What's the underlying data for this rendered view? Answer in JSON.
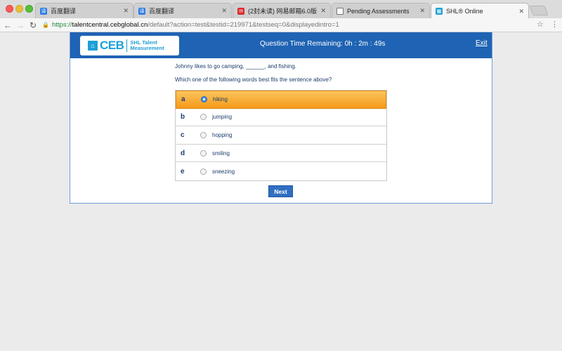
{
  "browser": {
    "tabs": [
      {
        "label": "百度翻译",
        "icon": "baidu-translate-icon"
      },
      {
        "label": "百度翻译",
        "icon": "baidu-translate-icon"
      },
      {
        "label": "(2封未读) 网易邮箱6.0版",
        "icon": "netease-mail-icon"
      },
      {
        "label": "Pending Assessments",
        "icon": "document-icon"
      },
      {
        "label": "SHL® Online",
        "icon": "shl-icon"
      }
    ],
    "active_tab": 4,
    "url_scheme": "https://",
    "url_host": "talentcentral.cebglobal.cn",
    "url_path": "/default?action=test&testid=219971&testseq=0&displayedintro=1"
  },
  "header": {
    "logo_text": "CEB",
    "logo_sub_line1": "SHL Talent",
    "logo_sub_line2": "Measurement",
    "timer": "Question Time Remaining: 0h : 2m : 49s",
    "exit_label": "Exit",
    "brand_color": "#1f63b4"
  },
  "question": {
    "sentence": "Johnny likes to go camping, ______, and fishing.",
    "prompt": "Which one of the following words best fits the sentence above?"
  },
  "options": [
    {
      "letter": "a",
      "text": "hiking",
      "selected": true
    },
    {
      "letter": "b",
      "text": "jumping",
      "selected": false
    },
    {
      "letter": "c",
      "text": "hopping",
      "selected": false
    },
    {
      "letter": "d",
      "text": "smiling",
      "selected": false
    },
    {
      "letter": "e",
      "text": "sneezing",
      "selected": false
    }
  ],
  "next_label": "Next"
}
